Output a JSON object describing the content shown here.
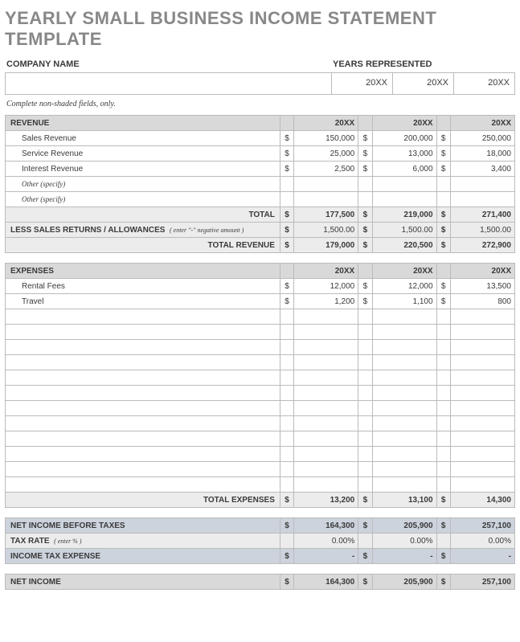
{
  "title": "YEARLY SMALL BUSINESS INCOME STATEMENT TEMPLATE",
  "headers": {
    "company": "COMPANY NAME",
    "years": "YEARS REPRESENTED"
  },
  "yearLabels": [
    "20XX",
    "20XX",
    "20XX"
  ],
  "note": "Complete non-shaded fields, only.",
  "revenue": {
    "title": "REVENUE",
    "years": [
      "20XX",
      "20XX",
      "20XX"
    ],
    "rows": [
      {
        "label": "Sales Revenue",
        "v": [
          "150,000",
          "200,000",
          "250,000"
        ]
      },
      {
        "label": "Service Revenue",
        "v": [
          "25,000",
          "13,000",
          "18,000"
        ]
      },
      {
        "label": "Interest Revenue",
        "v": [
          "2,500",
          "6,000",
          "3,400"
        ]
      },
      {
        "label": "Other (specify)",
        "v": [
          "",
          "",
          ""
        ],
        "italic": true
      },
      {
        "label": "Other (specify)",
        "v": [
          "",
          "",
          ""
        ],
        "italic": true
      }
    ],
    "total": {
      "label": "TOTAL",
      "v": [
        "177,500",
        "219,000",
        "271,400"
      ]
    },
    "less": {
      "label": "LESS SALES RETURNS / ALLOWANCES",
      "hint": "( enter \"-\" negative amount )",
      "v": [
        "1,500.00",
        "1,500.00",
        "1,500.00"
      ]
    },
    "totalRevenue": {
      "label": "TOTAL REVENUE",
      "v": [
        "179,000",
        "220,500",
        "272,900"
      ]
    }
  },
  "expenses": {
    "title": "EXPENSES",
    "years": [
      "20XX",
      "20XX",
      "20XX"
    ],
    "rows": [
      {
        "label": "Rental Fees",
        "v": [
          "12,000",
          "12,000",
          "13,500"
        ]
      },
      {
        "label": "Travel",
        "v": [
          "1,200",
          "1,100",
          "800"
        ]
      }
    ],
    "blankRows": 12,
    "total": {
      "label": "TOTAL EXPENSES",
      "v": [
        "13,200",
        "13,100",
        "14,300"
      ]
    }
  },
  "summary": {
    "before": {
      "label": "NET INCOME BEFORE TAXES",
      "v": [
        "164,300",
        "205,900",
        "257,100"
      ]
    },
    "taxRate": {
      "label": "TAX RATE",
      "hint": "( enter % )",
      "v": [
        "0.00%",
        "0.00%",
        "0.00%"
      ]
    },
    "taxExpense": {
      "label": "INCOME TAX EXPENSE",
      "v": [
        "-",
        "-",
        "-"
      ]
    },
    "net": {
      "label": "NET INCOME",
      "v": [
        "164,300",
        "205,900",
        "257,100"
      ]
    }
  },
  "dollar": "$"
}
